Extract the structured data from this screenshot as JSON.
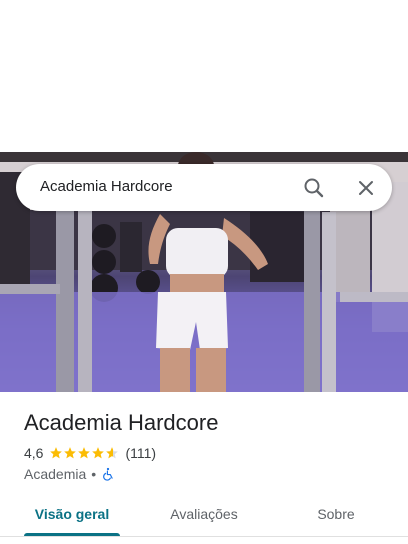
{
  "search": {
    "query": "Academia Hardcore"
  },
  "place": {
    "name": "Academia Hardcore",
    "rating_text": "4,6",
    "rating_value": 4.6,
    "review_count_text": "(111)",
    "category": "Academia",
    "separator": "•",
    "accessibility_icon": "wheelchair-icon"
  },
  "tabs": [
    {
      "label": "Visão geral",
      "active": true
    },
    {
      "label": "Avaliações",
      "active": false
    },
    {
      "label": "Sobre",
      "active": false
    }
  ],
  "colors": {
    "accent": "#0b7285",
    "star": "#fbbc04",
    "accessibility": "#1a73e8"
  }
}
